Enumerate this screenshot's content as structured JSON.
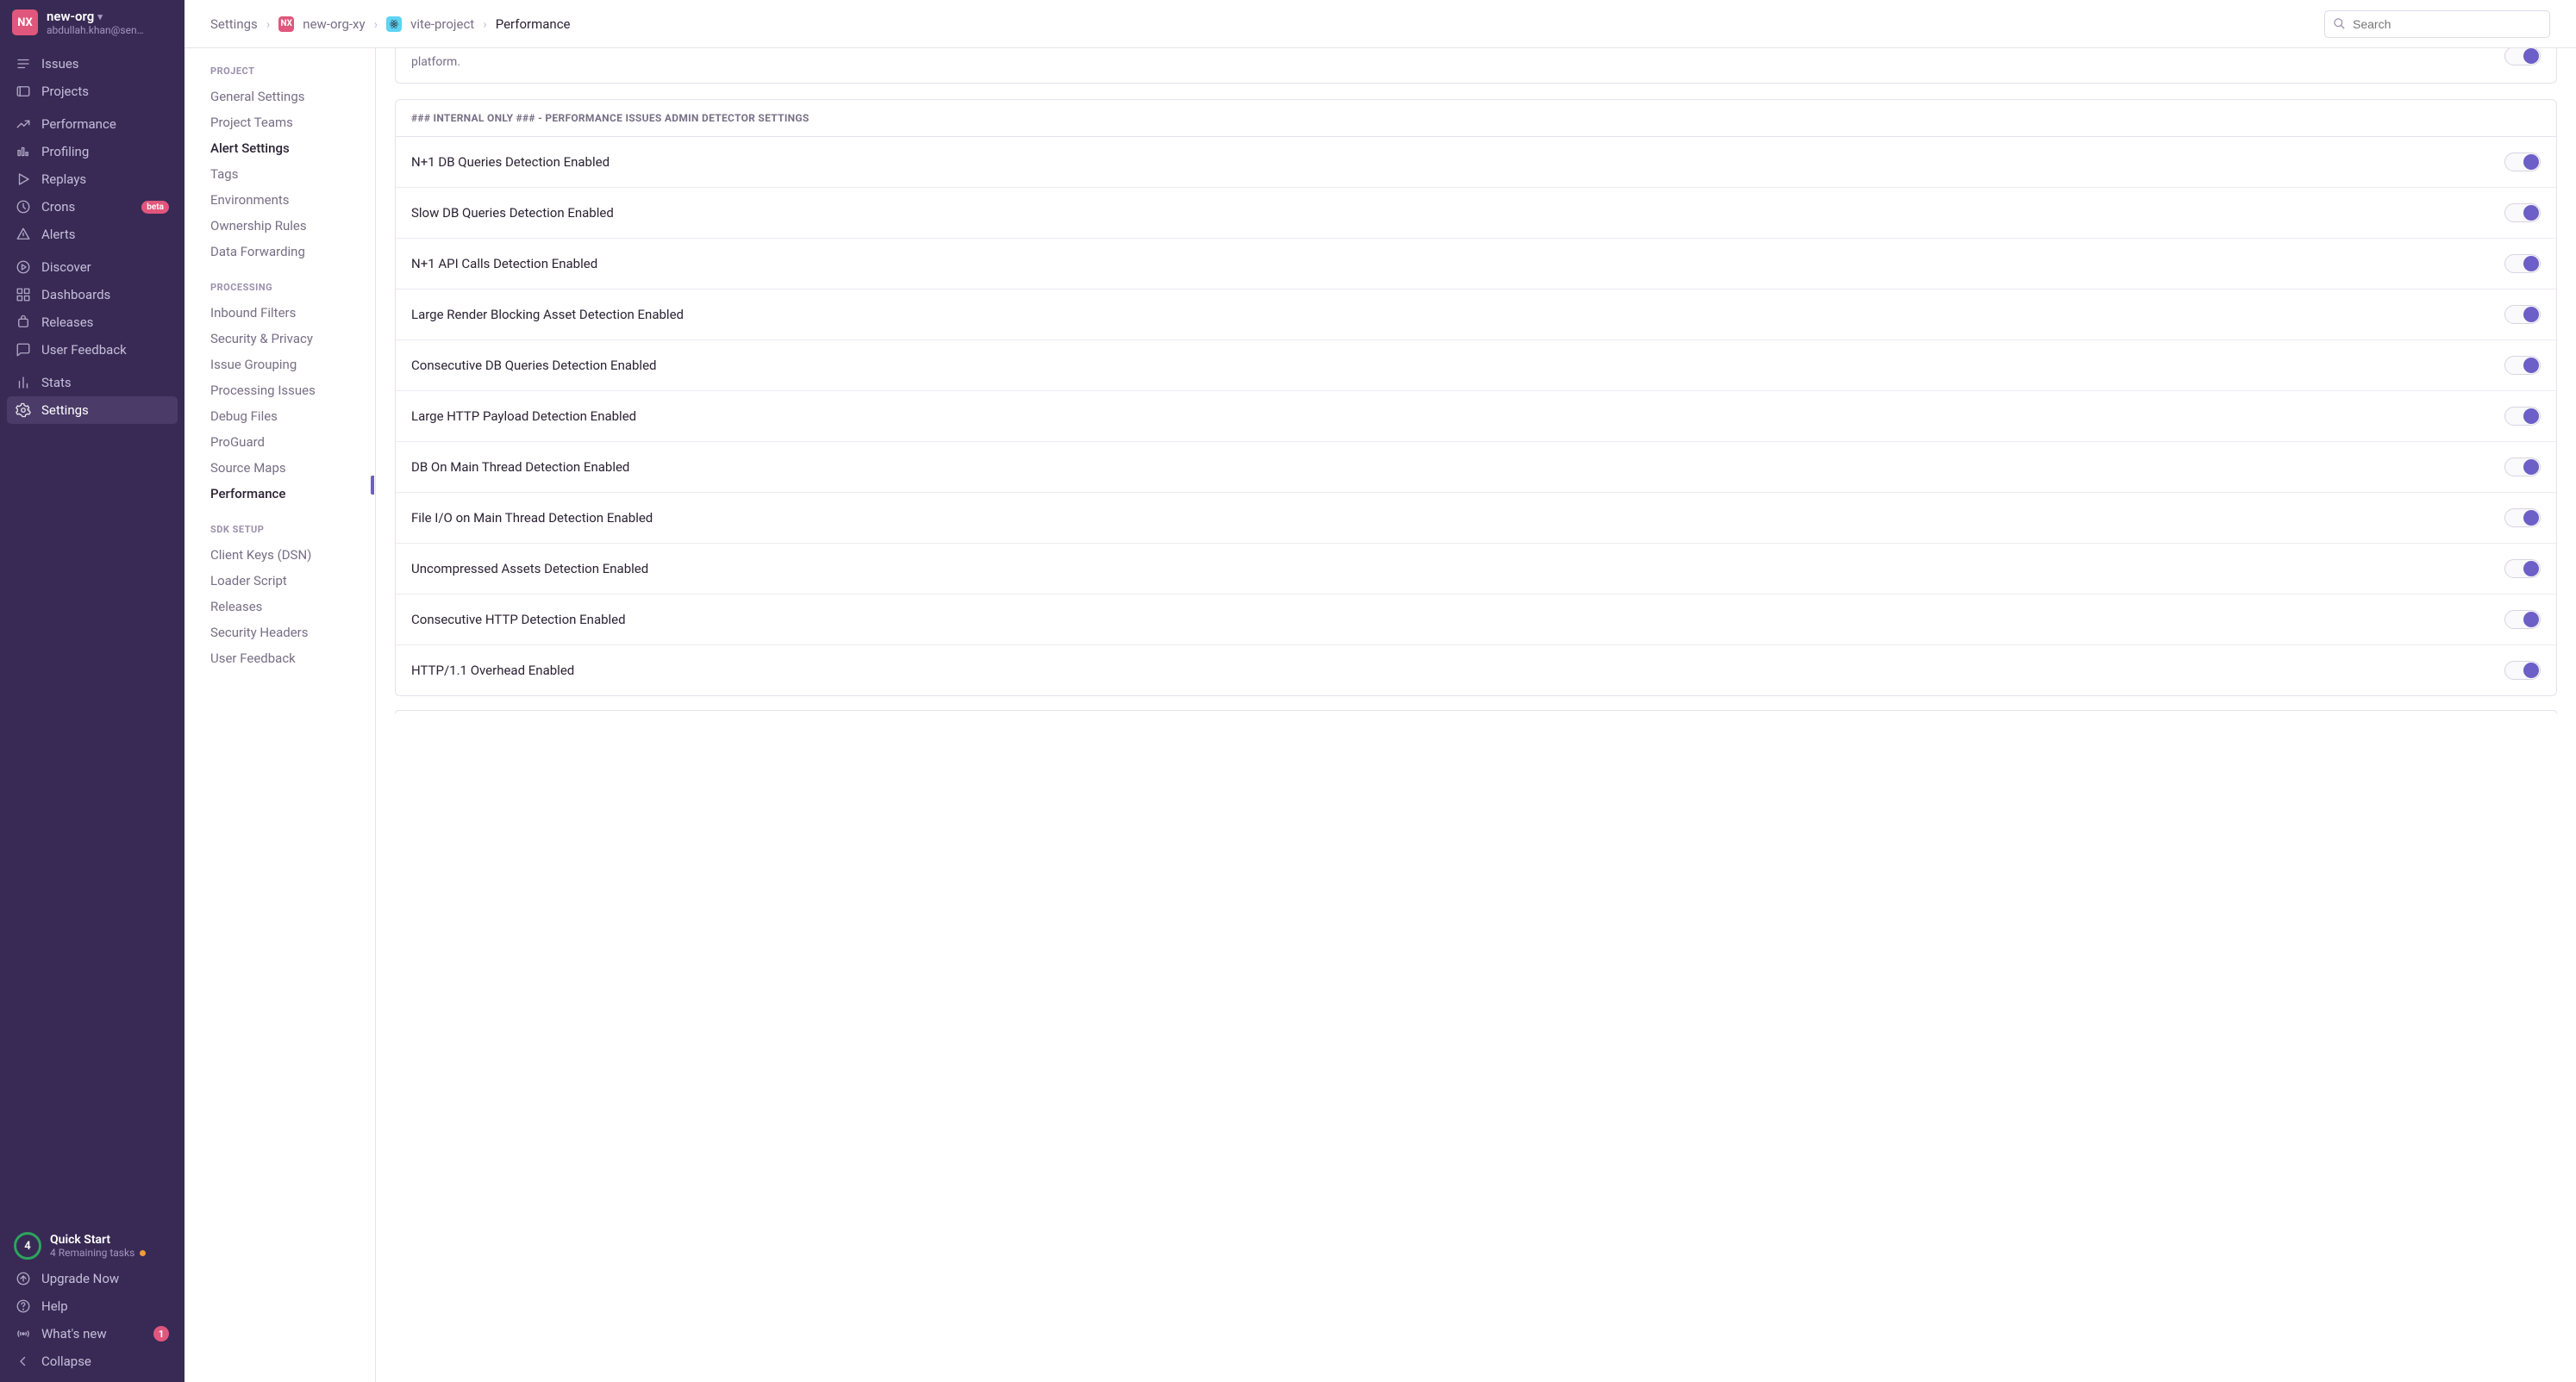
{
  "org": {
    "avatar": "NX",
    "name": "new-org",
    "email": "abdullah.khan@sen…"
  },
  "sidebar": {
    "groups": [
      {
        "items": [
          {
            "name": "issues",
            "label": "Issues",
            "icon": "issues"
          },
          {
            "name": "projects",
            "label": "Projects",
            "icon": "projects"
          }
        ]
      },
      {
        "items": [
          {
            "name": "performance",
            "label": "Performance",
            "icon": "performance"
          },
          {
            "name": "profiling",
            "label": "Profiling",
            "icon": "profiling"
          },
          {
            "name": "replays",
            "label": "Replays",
            "icon": "replays"
          },
          {
            "name": "crons",
            "label": "Crons",
            "icon": "crons",
            "badge": "beta"
          },
          {
            "name": "alerts",
            "label": "Alerts",
            "icon": "alerts"
          }
        ]
      },
      {
        "items": [
          {
            "name": "discover",
            "label": "Discover",
            "icon": "discover"
          },
          {
            "name": "dashboards",
            "label": "Dashboards",
            "icon": "dashboards"
          },
          {
            "name": "releases",
            "label": "Releases",
            "icon": "releases"
          },
          {
            "name": "user-feedback",
            "label": "User Feedback",
            "icon": "feedback"
          }
        ]
      },
      {
        "items": [
          {
            "name": "stats",
            "label": "Stats",
            "icon": "stats"
          },
          {
            "name": "settings",
            "label": "Settings",
            "icon": "settings",
            "active": true
          }
        ]
      }
    ],
    "quickstart": {
      "count": "4",
      "title": "Quick Start",
      "subtitle": "4 Remaining tasks"
    },
    "footer": [
      {
        "name": "upgrade",
        "label": "Upgrade Now",
        "icon": "upgrade"
      },
      {
        "name": "help",
        "label": "Help",
        "icon": "help"
      },
      {
        "name": "whats-new",
        "label": "What's new",
        "icon": "broadcast",
        "notif": "1"
      },
      {
        "name": "collapse",
        "label": "Collapse",
        "icon": "collapse"
      }
    ]
  },
  "breadcrumb": {
    "root": "Settings",
    "org_avatar": "NX",
    "org": "new-org-xy",
    "project": "vite-project",
    "page": "Performance"
  },
  "search": {
    "placeholder": "Search"
  },
  "subnav": {
    "sections": [
      {
        "heading": "PROJECT",
        "items": [
          {
            "label": "General Settings"
          },
          {
            "label": "Project Teams"
          },
          {
            "label": "Alert Settings",
            "active": true
          },
          {
            "label": "Tags"
          },
          {
            "label": "Environments"
          },
          {
            "label": "Ownership Rules"
          },
          {
            "label": "Data Forwarding"
          }
        ]
      },
      {
        "heading": "PROCESSING",
        "items": [
          {
            "label": "Inbound Filters"
          },
          {
            "label": "Security & Privacy"
          },
          {
            "label": "Issue Grouping"
          },
          {
            "label": "Processing Issues"
          },
          {
            "label": "Debug Files"
          },
          {
            "label": "ProGuard"
          },
          {
            "label": "Source Maps"
          },
          {
            "label": "Performance",
            "active": true
          }
        ]
      },
      {
        "heading": "SDK SETUP",
        "items": [
          {
            "label": "Client Keys (DSN)"
          },
          {
            "label": "Loader Script"
          },
          {
            "label": "Releases"
          },
          {
            "label": "Security Headers"
          },
          {
            "label": "User Feedback"
          }
        ]
      }
    ]
  },
  "tail_panel": {
    "text": "platform.",
    "toggle_on": true
  },
  "detector_panel": {
    "heading": "### INTERNAL ONLY ### - PERFORMANCE ISSUES ADMIN DETECTOR SETTINGS",
    "settings": [
      {
        "label": "N+1 DB Queries Detection Enabled",
        "on": true
      },
      {
        "label": "Slow DB Queries Detection Enabled",
        "on": true
      },
      {
        "label": "N+1 API Calls Detection Enabled",
        "on": true
      },
      {
        "label": "Large Render Blocking Asset Detection Enabled",
        "on": true
      },
      {
        "label": "Consecutive DB Queries Detection Enabled",
        "on": true
      },
      {
        "label": "Large HTTP Payload Detection Enabled",
        "on": true
      },
      {
        "label": "DB On Main Thread Detection Enabled",
        "on": true
      },
      {
        "label": "File I/O on Main Thread Detection Enabled",
        "on": true
      },
      {
        "label": "Uncompressed Assets Detection Enabled",
        "on": true
      },
      {
        "label": "Consecutive HTTP Detection Enabled",
        "on": true
      },
      {
        "label": "HTTP/1.1 Overhead Enabled",
        "on": true
      }
    ]
  }
}
